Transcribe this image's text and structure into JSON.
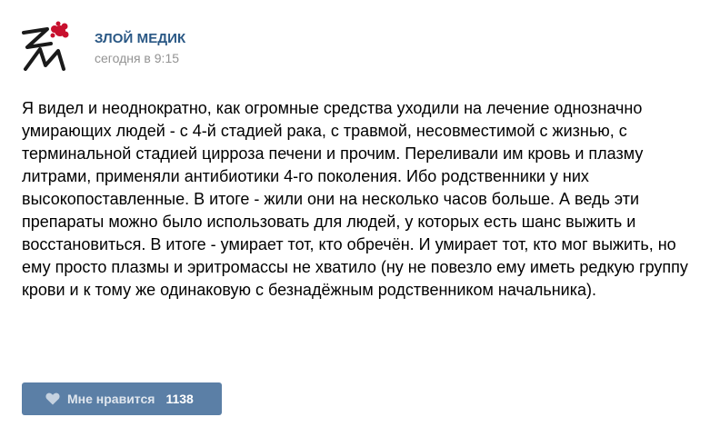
{
  "post": {
    "author": "ЗЛОЙ МЕДИК",
    "time": "сегодня в 9:15",
    "avatar_icon": "zm-logo-icon",
    "text": "Я видел и неоднократно, как огромные средства уходили на лечение однозначно умирающих людей - с 4-й стадией рака, с травмой, несовместимой с жизнью, с терминальной стадией цирроза печени и прочим. Переливали им кровь и плазму литрами, применяли антибиотики 4-го поколения. Ибо родственники у них высокопоставленные. В итоге - жили они на несколько часов больше. А ведь эти препараты можно было использовать для людей, у которых есть шанс выжить и восстановиться. В итоге - умирает тот, кто обречён. И умирает тот, кто мог выжить, но ему просто плазмы и эритромассы не хватило (ну не повезло ему иметь редкую группу крови и к тому же одинаковую с безнадёжным родственником начальника)."
  },
  "like": {
    "icon": "heart-icon",
    "label": "Мне нравится",
    "count": "1138"
  },
  "colors": {
    "author": "#2a5885",
    "time": "#939393",
    "like_bg": "#5b7fa6",
    "logo_red": "#c8102e"
  }
}
